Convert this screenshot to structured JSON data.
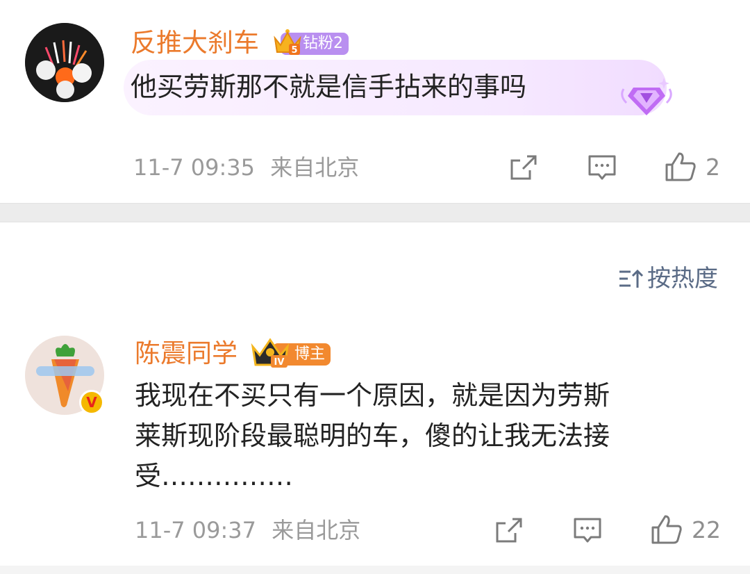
{
  "comments": [
    {
      "username": "反推大刹车",
      "badge_label": "钻粉2",
      "crown_level": "5",
      "text": "他买劳斯那不就是信手拈来的事吗",
      "time": "11-7 09:35",
      "location": "来自北京",
      "likes": "2",
      "accent": "#eb7a2c"
    },
    {
      "username": "陈震同学",
      "badge_label": "博主",
      "crown_level": "IV",
      "text_line1": "我现在不买只有一个原因，就是因为劳斯",
      "text_line2": "莱斯现阶段最聪明的车，傻的让我无法接",
      "text_line3": "受……………",
      "time": "11-7 09:37",
      "location": "来自北京",
      "likes": "22",
      "verified": "V",
      "accent": "#eb7a2c"
    }
  ],
  "sort": {
    "label": "按热度"
  }
}
